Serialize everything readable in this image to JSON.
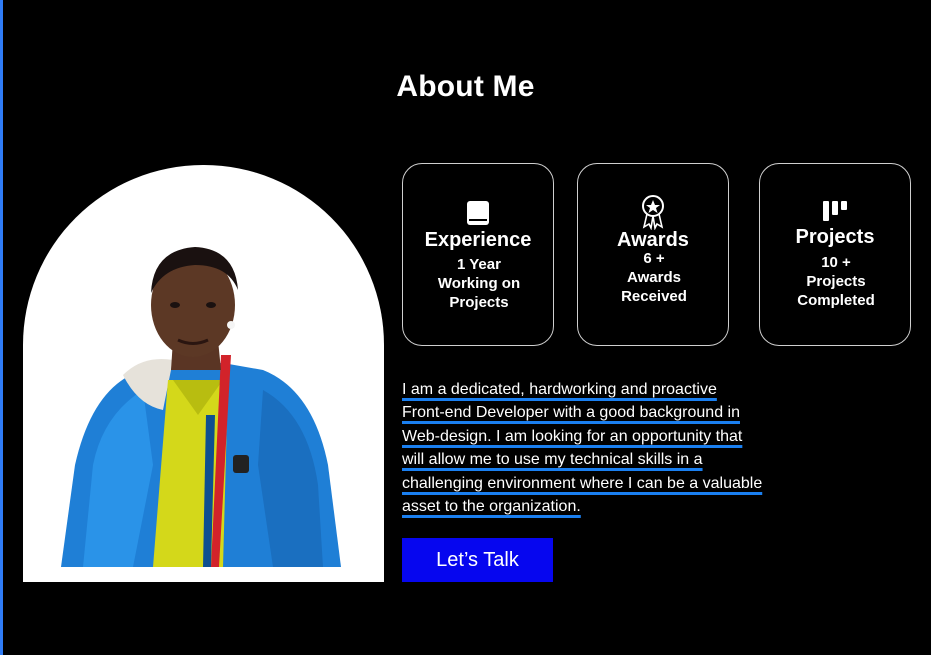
{
  "section": {
    "title": "About Me"
  },
  "cards": [
    {
      "icon": "book-icon",
      "title": "Experience",
      "lines": [
        "1 Year",
        "Working on",
        "Projects"
      ]
    },
    {
      "icon": "award-ribbon-icon",
      "title": "Awards",
      "lines": [
        "6 +",
        "Awards",
        "Received"
      ]
    },
    {
      "icon": "kanban-board-icon",
      "title": "Projects",
      "lines": [
        "10 +",
        "Projects",
        "Completed"
      ]
    }
  ],
  "about": {
    "lines": [
      "I am a dedicated, hardworking and proactive",
      "Front-end Developer with a good background in",
      "Web-design. I am looking for an opportunity that",
      "will allow me to use my technical skills in a",
      "challenging environment where I can be a valuable",
      "asset to the organization."
    ]
  },
  "cta": {
    "label": "Let’s Talk"
  },
  "colors": {
    "background": "#000000",
    "accent_underline": "#1a7ff0",
    "button": "#0606ef",
    "card_border": "#cfcfcf"
  }
}
